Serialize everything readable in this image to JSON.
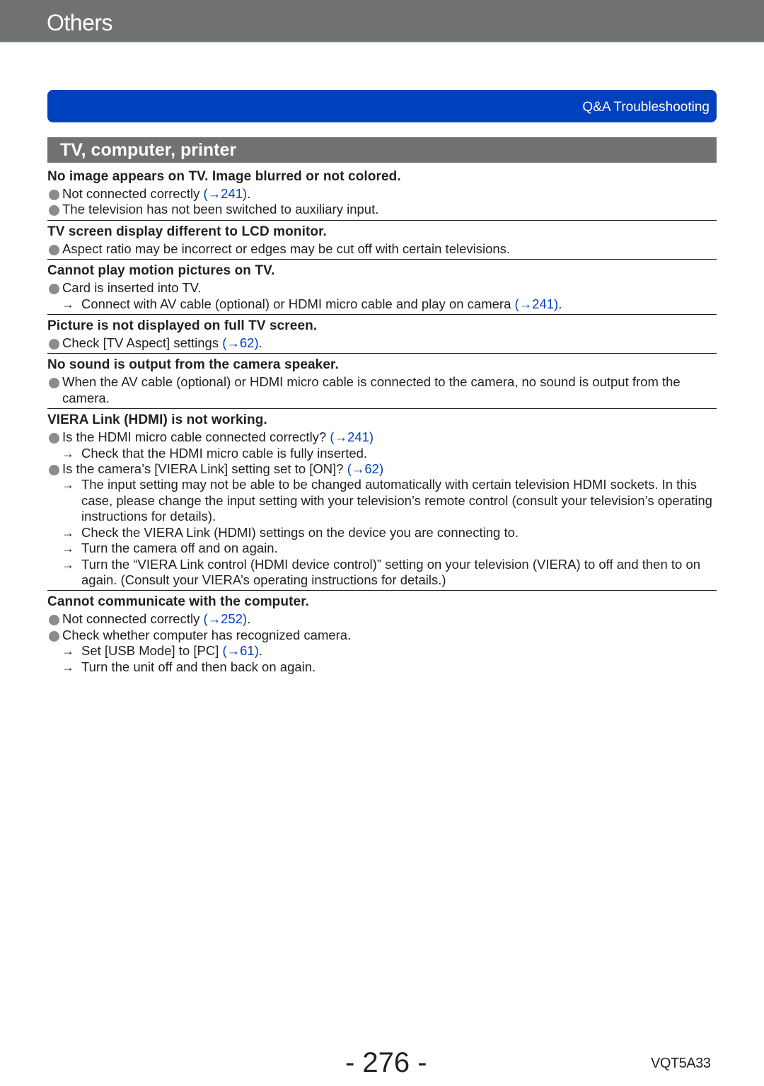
{
  "header": {
    "title": "Others"
  },
  "breadcrumb": {
    "label": "Q&A  Troubleshooting"
  },
  "section": {
    "title": "TV, computer, printer"
  },
  "qa": [
    {
      "question": "No image appears on TV. Image blurred or not colored.",
      "lines": [
        {
          "type": "bullet",
          "text": "Not connected correctly ",
          "ref": "(→241)",
          "tail": "."
        },
        {
          "type": "bullet",
          "text": "The television has not been switched to auxiliary input.",
          "ref": "",
          "tail": ""
        }
      ]
    },
    {
      "question": "TV screen display different to LCD monitor.",
      "lines": [
        {
          "type": "bullet",
          "text": "Aspect ratio may be incorrect or edges may be cut off with certain televisions.",
          "ref": "",
          "tail": ""
        }
      ]
    },
    {
      "question": "Cannot play motion pictures on TV.",
      "lines": [
        {
          "type": "bullet",
          "text": "Card is inserted into TV.",
          "ref": "",
          "tail": ""
        },
        {
          "type": "arrow",
          "text": "Connect with AV cable (optional) or HDMI micro cable and play on camera ",
          "ref": "(→241)",
          "tail": "."
        }
      ]
    },
    {
      "question": "Picture is not displayed on full TV screen.",
      "lines": [
        {
          "type": "bullet",
          "text": "Check [TV Aspect] settings ",
          "ref": "(→62)",
          "tail": "."
        }
      ]
    },
    {
      "question": "No sound is output from the camera speaker.",
      "lines": [
        {
          "type": "bullet",
          "text": "When the AV cable (optional) or HDMI micro cable is connected to the camera, no sound is output from the camera.",
          "ref": "",
          "tail": ""
        }
      ]
    },
    {
      "question": "VIERA Link (HDMI) is not working.",
      "lines": [
        {
          "type": "bullet",
          "text": "Is the HDMI micro cable connected correctly? ",
          "ref": "(→241)",
          "tail": ""
        },
        {
          "type": "arrow",
          "text": "Check that the HDMI micro cable is fully inserted.",
          "ref": "",
          "tail": ""
        },
        {
          "type": "bullet",
          "text": "Is the camera’s [VIERA Link] setting set to [ON]? ",
          "ref": "(→62)",
          "tail": ""
        },
        {
          "type": "arrow",
          "text": "The input setting may not be able to be changed automatically with certain television HDMI sockets. In this case, please change the input setting with your television’s remote control (consult your television’s operating instructions for details).",
          "ref": "",
          "tail": ""
        },
        {
          "type": "arrow",
          "text": "Check the VIERA Link (HDMI) settings on the device you are connecting to.",
          "ref": "",
          "tail": ""
        },
        {
          "type": "arrow",
          "text": "Turn the camera off and on again.",
          "ref": "",
          "tail": ""
        },
        {
          "type": "arrow",
          "text": "Turn the “VIERA Link control (HDMI device control)” setting on your television (VIERA) to off and then to on again. (Consult your VIERA’s operating instructions for details.)",
          "ref": "",
          "tail": ""
        }
      ]
    },
    {
      "question": "Cannot communicate with the computer.",
      "lines": [
        {
          "type": "bullet",
          "text": "Not connected correctly ",
          "ref": "(→252)",
          "tail": "."
        },
        {
          "type": "bullet",
          "text": "Check whether computer has recognized camera.",
          "ref": "",
          "tail": ""
        },
        {
          "type": "arrow",
          "text": "Set [USB Mode] to [PC] ",
          "ref": "(→61)",
          "tail": "."
        },
        {
          "type": "arrow",
          "text": "Turn the unit off and then back on again.",
          "ref": "",
          "tail": ""
        }
      ]
    }
  ],
  "footer": {
    "page_number": "- 276 -",
    "model_code": "VQT5A33"
  },
  "icons": {
    "bullet": "bullet-dot-icon",
    "arrow": "→"
  },
  "colors": {
    "header_gray": "#717273",
    "accent_blue": "#0041c0",
    "text": "#231f20",
    "bullet_gray": "#8c8c8c"
  }
}
